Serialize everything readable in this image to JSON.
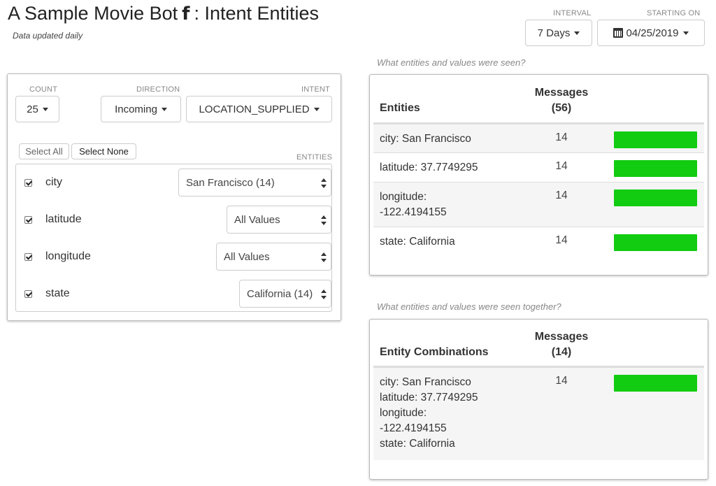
{
  "header": {
    "title_prefix": "A Sample Movie Bot",
    "title_suffix": ": Intent Entities",
    "platform_icon": "facebook-icon",
    "subtitle": "Data updated daily"
  },
  "top_controls": {
    "interval_label": "INTERVAL",
    "interval_value": "7 Days",
    "starting_on_label": "STARTING ON",
    "starting_on_value": "04/25/2019"
  },
  "filters": {
    "count_label": "COUNT",
    "count_value": "25",
    "direction_label": "DIRECTION",
    "direction_value": "Incoming",
    "intent_label": "INTENT",
    "intent_value": "LOCATION_SUPPLIED",
    "select_all": "Select All",
    "select_none": "Select None",
    "entities_label": "ENTITIES",
    "entities": [
      {
        "name": "city",
        "checked": true,
        "value": "San Francisco (14)"
      },
      {
        "name": "latitude",
        "checked": true,
        "value": "All Values"
      },
      {
        "name": "longitude",
        "checked": true,
        "value": "All Values"
      },
      {
        "name": "state",
        "checked": true,
        "value": "California (14)"
      }
    ]
  },
  "entities_table": {
    "question": "What entities and values were seen?",
    "col_entities": "Entities",
    "col_messages": "Messages",
    "col_messages_total": "(56)",
    "rows": [
      {
        "key": "city",
        "value": ": San Francisco",
        "count": "14",
        "fraction": 1.0
      },
      {
        "key": "latitude",
        "value": ": 37.7749295",
        "count": "14",
        "fraction": 1.0
      },
      {
        "key": "longitude",
        "value": ":",
        "value2": "-122.4194155",
        "count": "14",
        "fraction": 1.0
      },
      {
        "key": "state",
        "value": ": California",
        "count": "14",
        "fraction": 1.0
      }
    ]
  },
  "combinations_table": {
    "question": "What entities and values were seen together?",
    "col_entities": "Entity Combinations",
    "col_messages": "Messages",
    "col_messages_total": "(14)",
    "rows": [
      {
        "lines": [
          {
            "key": "city",
            "value": ": San Francisco"
          },
          {
            "key": "latitude",
            "value": ": 37.7749295"
          },
          {
            "key": "longitude",
            "value": ":"
          },
          {
            "key": "",
            "value": "-122.4194155"
          },
          {
            "key": "state",
            "value": ": California"
          }
        ],
        "count": "14",
        "fraction": 1.0
      }
    ]
  },
  "colors": {
    "bar": "#11cc11"
  }
}
